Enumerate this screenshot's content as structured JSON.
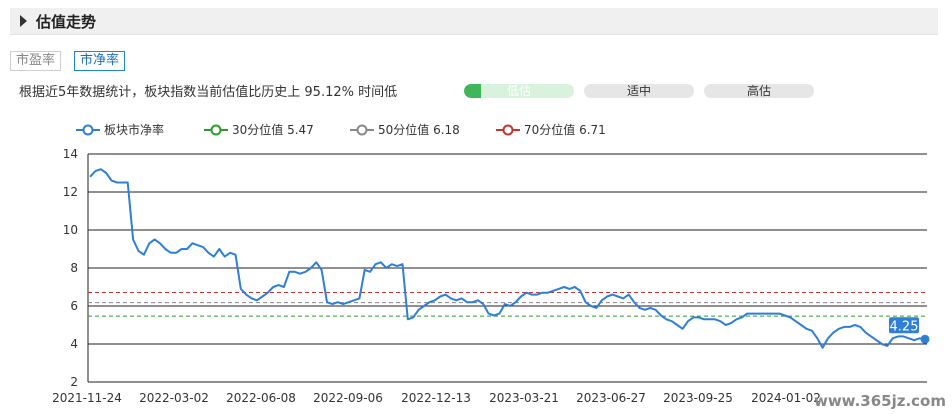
{
  "header": {
    "title": "估值走势"
  },
  "tabs": [
    {
      "label": "市盈率",
      "active": false
    },
    {
      "label": "市净率",
      "active": true
    }
  ],
  "description": "根据近5年数据统计，板块指数当前估值比历史上 95.12% 时间低",
  "scale": {
    "low": "低估",
    "mid": "适中",
    "high": "高估",
    "low_fill_fraction": 0.15
  },
  "watermark": "www.365jz.com",
  "colors": {
    "series": "#2f7ed8",
    "p30": "#2a9d2a",
    "p50": "#888888",
    "p70": "#c23531"
  },
  "chart_data": {
    "type": "line",
    "ylim": [
      2,
      14
    ],
    "yticks": [
      "2",
      "4",
      "6",
      "8",
      "10",
      "12",
      "14"
    ],
    "xticks": [
      "2021-11-24",
      "2022-03-02",
      "2022-06-08",
      "2022-09-06",
      "2022-12-13",
      "2023-03-21",
      "2023-06-27",
      "2023-09-25",
      "2024-01-02"
    ],
    "legend": [
      {
        "label": "板块市净率",
        "color": "#2f7ed8"
      },
      {
        "label": "30分位值 5.47",
        "color": "#2a9d2a"
      },
      {
        "label": "50分位值 6.18",
        "color": "#888888"
      },
      {
        "label": "70分位值 6.71",
        "color": "#c23531"
      }
    ],
    "reference_lines": [
      {
        "name": "30分位值",
        "value": 5.47,
        "color": "#2a9d2a"
      },
      {
        "name": "50分位值",
        "value": 6.18,
        "color": "#888888"
      },
      {
        "name": "70分位值",
        "value": 6.71,
        "color": "#c23531"
      }
    ],
    "last_value_label": "4.25",
    "series": [
      {
        "name": "板块市净率",
        "color": "#2f7ed8",
        "values": [
          12.8,
          13.1,
          13.2,
          13.0,
          12.6,
          12.5,
          12.5,
          12.5,
          9.5,
          8.9,
          8.7,
          9.3,
          9.5,
          9.3,
          9.0,
          8.8,
          8.8,
          9.0,
          9.0,
          9.3,
          9.2,
          9.1,
          8.8,
          8.6,
          9.0,
          8.6,
          8.8,
          8.7,
          6.9,
          6.6,
          6.4,
          6.3,
          6.5,
          6.7,
          7.0,
          7.1,
          7.0,
          7.8,
          7.8,
          7.7,
          7.8,
          8.0,
          8.3,
          7.9,
          6.2,
          6.1,
          6.2,
          6.1,
          6.2,
          6.3,
          6.4,
          7.9,
          7.8,
          8.2,
          8.3,
          8.0,
          8.2,
          8.1,
          8.2,
          5.3,
          5.4,
          5.8,
          6.0,
          6.2,
          6.3,
          6.5,
          6.6,
          6.4,
          6.3,
          6.4,
          6.2,
          6.2,
          6.3,
          6.1,
          5.6,
          5.5,
          5.6,
          6.1,
          6.0,
          6.2,
          6.5,
          6.7,
          6.6,
          6.6,
          6.7,
          6.7,
          6.8,
          6.9,
          7.0,
          6.9,
          7.0,
          6.8,
          6.2,
          6.0,
          5.9,
          6.3,
          6.5,
          6.6,
          6.5,
          6.4,
          6.6,
          6.2,
          5.9,
          5.8,
          5.9,
          5.8,
          5.5,
          5.3,
          5.2,
          5.0,
          4.8,
          5.2,
          5.4,
          5.4,
          5.3,
          5.3,
          5.3,
          5.2,
          5.0,
          5.1,
          5.3,
          5.4,
          5.6,
          5.6,
          5.6,
          5.6,
          5.6,
          5.6,
          5.6,
          5.5,
          5.4,
          5.2,
          5.0,
          4.8,
          4.7,
          4.3,
          3.8,
          4.3,
          4.6,
          4.8,
          4.9,
          4.9,
          5.0,
          4.9,
          4.6,
          4.4,
          4.2,
          4.0,
          3.9,
          4.3,
          4.4,
          4.4,
          4.3,
          4.2,
          4.3,
          4.25
        ]
      }
    ]
  }
}
